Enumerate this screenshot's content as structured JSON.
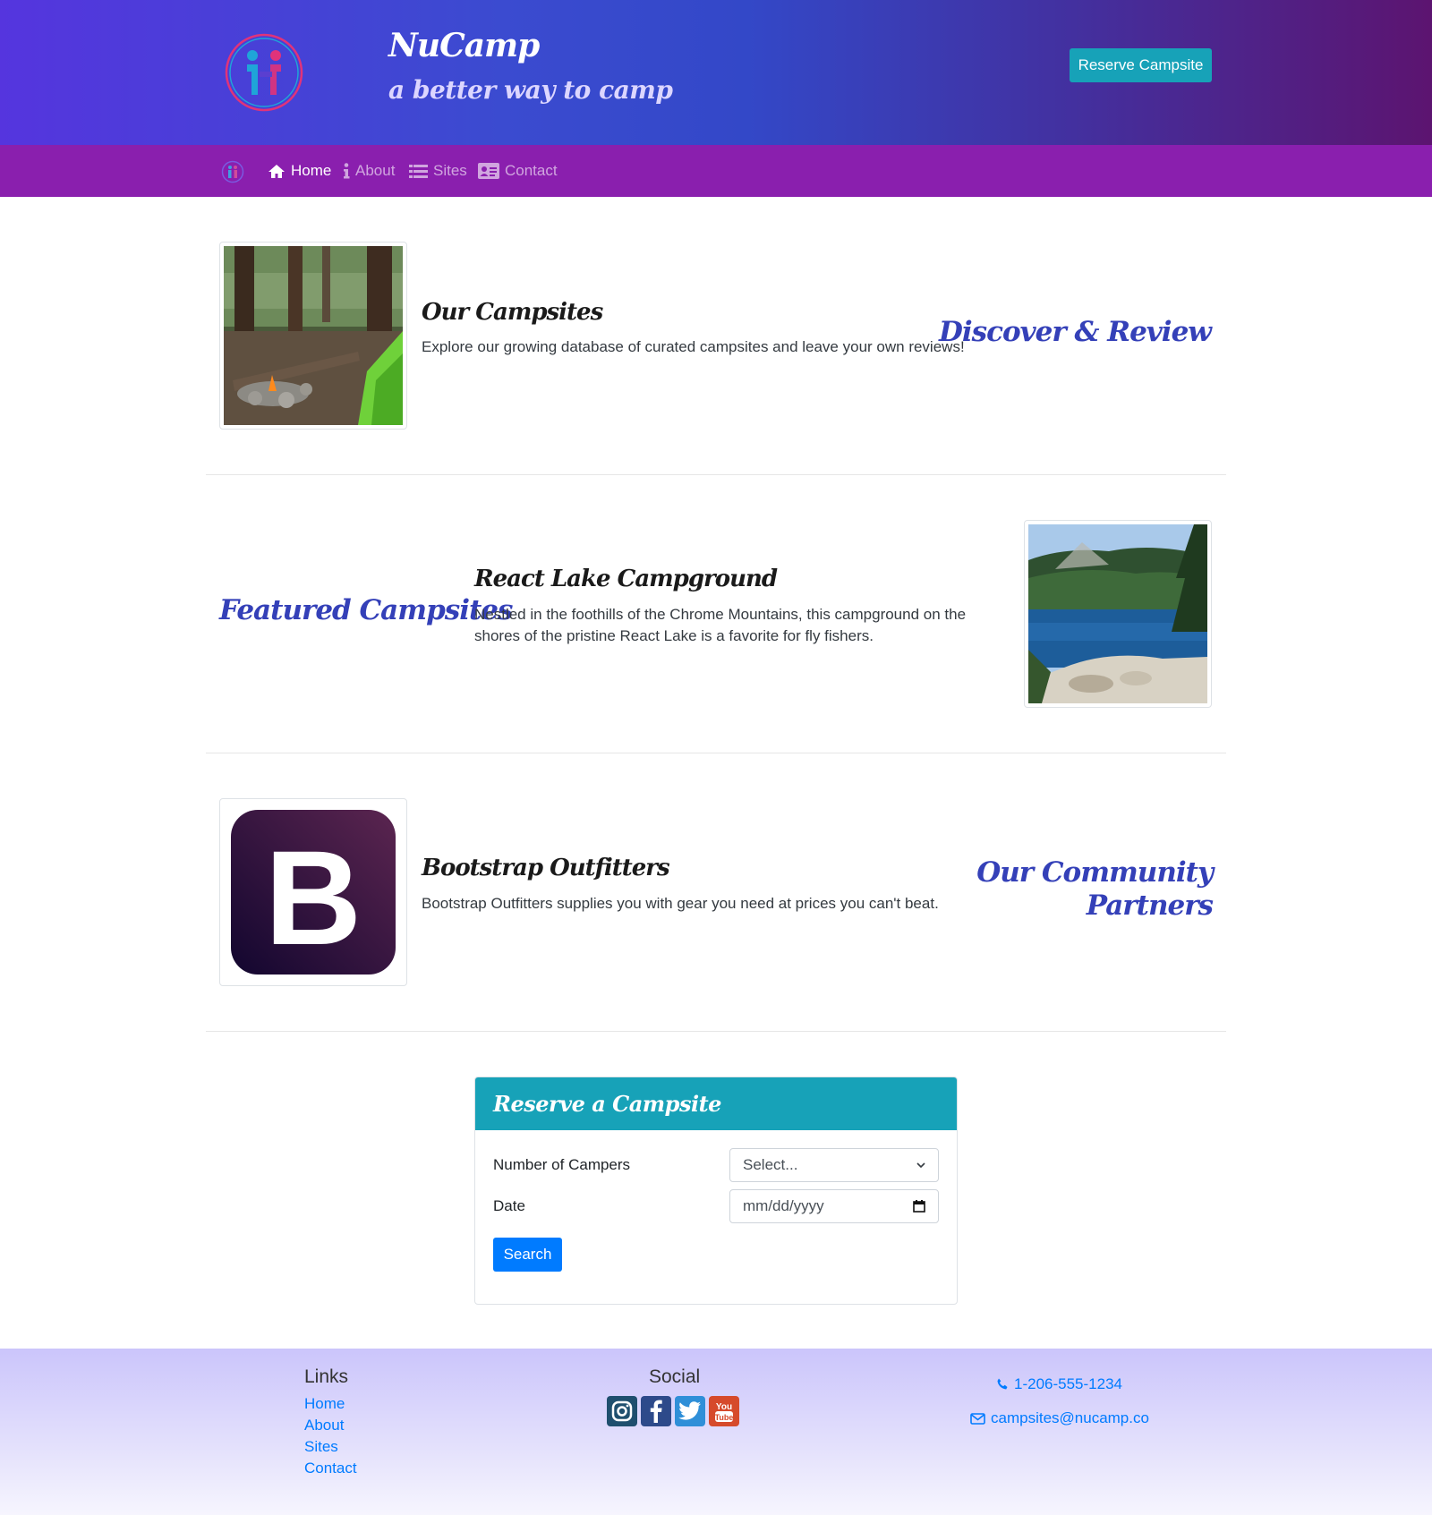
{
  "header": {
    "title": "NuCamp",
    "subtitle": "a better way to camp",
    "reserve_button": "Reserve Campsite"
  },
  "nav": {
    "items": [
      {
        "label": "Home",
        "icon": "home-icon",
        "active": true
      },
      {
        "label": "About",
        "icon": "info-icon",
        "active": false
      },
      {
        "label": "Sites",
        "icon": "list-icon",
        "active": false
      },
      {
        "label": "Contact",
        "icon": "address-card-icon",
        "active": false
      }
    ]
  },
  "sections": [
    {
      "title": "Our Campsites",
      "text": "Explore our growing database of curated campsites and leave your own reviews!",
      "heading": "Discover & Review"
    },
    {
      "title": "React Lake Campground",
      "text_lines": [
        "Nestled in the foothills of the Chrome Mountains, this campground on the",
        "shores of the pristine React Lake is a favorite for fly fishers."
      ],
      "heading": "Featured Campsites"
    },
    {
      "title": "Bootstrap Outfitters",
      "text": "Bootstrap Outfitters supplies you with gear you need at prices you can't beat.",
      "heading_lines": [
        "Our Community",
        "Partners"
      ],
      "logo_letter": "B"
    }
  ],
  "reservation": {
    "title": "Reserve a Campsite",
    "campers_label": "Number of Campers",
    "campers_value": "Select...",
    "date_label": "Date",
    "date_placeholder": "mm/dd/yyyy",
    "search_button": "Search"
  },
  "footer": {
    "links_heading": "Links",
    "links": [
      "Home",
      "About",
      "Sites",
      "Contact"
    ],
    "social_heading": "Social",
    "social": [
      "instagram-icon",
      "facebook-icon",
      "twitter-icon",
      "youtube-icon"
    ],
    "phone": "1-206-555-1234",
    "email": "campsites@nucamp.co"
  },
  "colors": {
    "navbar": "#8a1fae",
    "accent": "#17a2b8",
    "link": "#007bff",
    "script_heading": "#3440b8"
  }
}
